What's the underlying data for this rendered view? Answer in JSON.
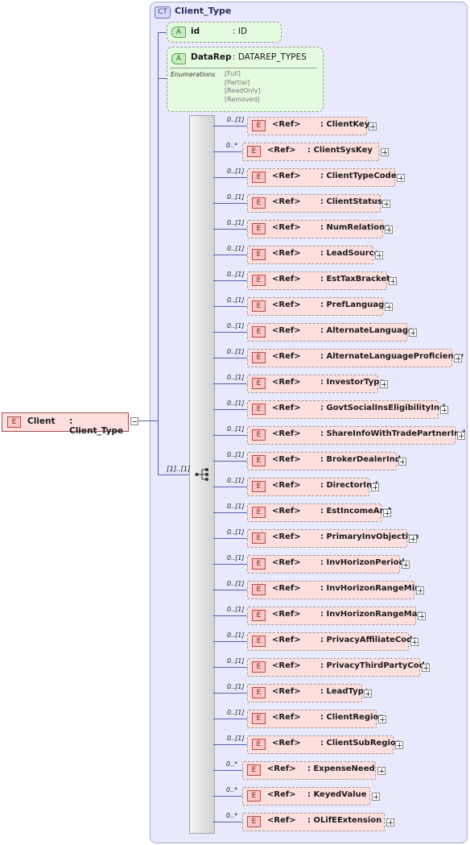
{
  "complex_type": {
    "badge": "CT",
    "title": "Client_Type"
  },
  "root_element": {
    "badge": "E",
    "name": "Client",
    "type": ": Client_Type"
  },
  "attributes": [
    {
      "badge": "A",
      "name": "id",
      "type": ": ID"
    },
    {
      "badge": "A",
      "name": "DataRep",
      "type": ": DATAREP_TYPES",
      "enumerations_label": "Enumerations",
      "enumerations": [
        "[Full]",
        "[Partial]",
        "[ReadOnly]",
        "[Removed]"
      ]
    }
  ],
  "sequence": {
    "cardinality": "[1]..[1]",
    "icon": "sequence-icon"
  },
  "elements": [
    {
      "card": "0..[1]",
      "ref": "<Ref>",
      "name": ": ClientKey"
    },
    {
      "card": "0..*",
      "ref": "<Ref>",
      "name": ": ClientSysKey"
    },
    {
      "card": "0..[1]",
      "ref": "<Ref>",
      "name": ": ClientTypeCode"
    },
    {
      "card": "0..[1]",
      "ref": "<Ref>",
      "name": ": ClientStatus"
    },
    {
      "card": "0..[1]",
      "ref": "<Ref>",
      "name": ": NumRelations"
    },
    {
      "card": "0..[1]",
      "ref": "<Ref>",
      "name": ": LeadSource"
    },
    {
      "card": "0..[1]",
      "ref": "<Ref>",
      "name": ": EstTaxBracket"
    },
    {
      "card": "0..[1]",
      "ref": "<Ref>",
      "name": ": PrefLanguage"
    },
    {
      "card": "0..[1]",
      "ref": "<Ref>",
      "name": ": AlternateLanguage"
    },
    {
      "card": "0..[1]",
      "ref": "<Ref>",
      "name": ": AlternateLanguageProficiency"
    },
    {
      "card": "0..[1]",
      "ref": "<Ref>",
      "name": ": InvestorType"
    },
    {
      "card": "0..[1]",
      "ref": "<Ref>",
      "name": ": GovtSocialInsEligibilityInd"
    },
    {
      "card": "0..[1]",
      "ref": "<Ref>",
      "name": ": ShareInfoWithTradePartnerInd"
    },
    {
      "card": "0..[1]",
      "ref": "<Ref>",
      "name": ": BrokerDealerInd"
    },
    {
      "card": "0..[1]",
      "ref": "<Ref>",
      "name": ": DirectorInd"
    },
    {
      "card": "0..[1]",
      "ref": "<Ref>",
      "name": ": EstIncomeAmt"
    },
    {
      "card": "0..[1]",
      "ref": "<Ref>",
      "name": ": PrimaryInvObjective"
    },
    {
      "card": "0..[1]",
      "ref": "<Ref>",
      "name": ": InvHorizonPeriod"
    },
    {
      "card": "0..[1]",
      "ref": "<Ref>",
      "name": ": InvHorizonRangeMin"
    },
    {
      "card": "0..[1]",
      "ref": "<Ref>",
      "name": ": InvHorizonRangeMax"
    },
    {
      "card": "0..[1]",
      "ref": "<Ref>",
      "name": ": PrivacyAffiliateCode"
    },
    {
      "card": "0..[1]",
      "ref": "<Ref>",
      "name": ": PrivacyThirdPartyCode"
    },
    {
      "card": "0..[1]",
      "ref": "<Ref>",
      "name": ": LeadType"
    },
    {
      "card": "0..[1]",
      "ref": "<Ref>",
      "name": ": ClientRegion"
    },
    {
      "card": "0..[1]",
      "ref": "<Ref>",
      "name": ": ClientSubRegion"
    },
    {
      "card": "0..*",
      "ref": "<Ref>",
      "name": ": ExpenseNeed"
    },
    {
      "card": "0..*",
      "ref": "<Ref>",
      "name": ": KeyedValue"
    },
    {
      "card": "0..*",
      "ref": "<Ref>",
      "name": ": OLifEExtension"
    }
  ]
}
